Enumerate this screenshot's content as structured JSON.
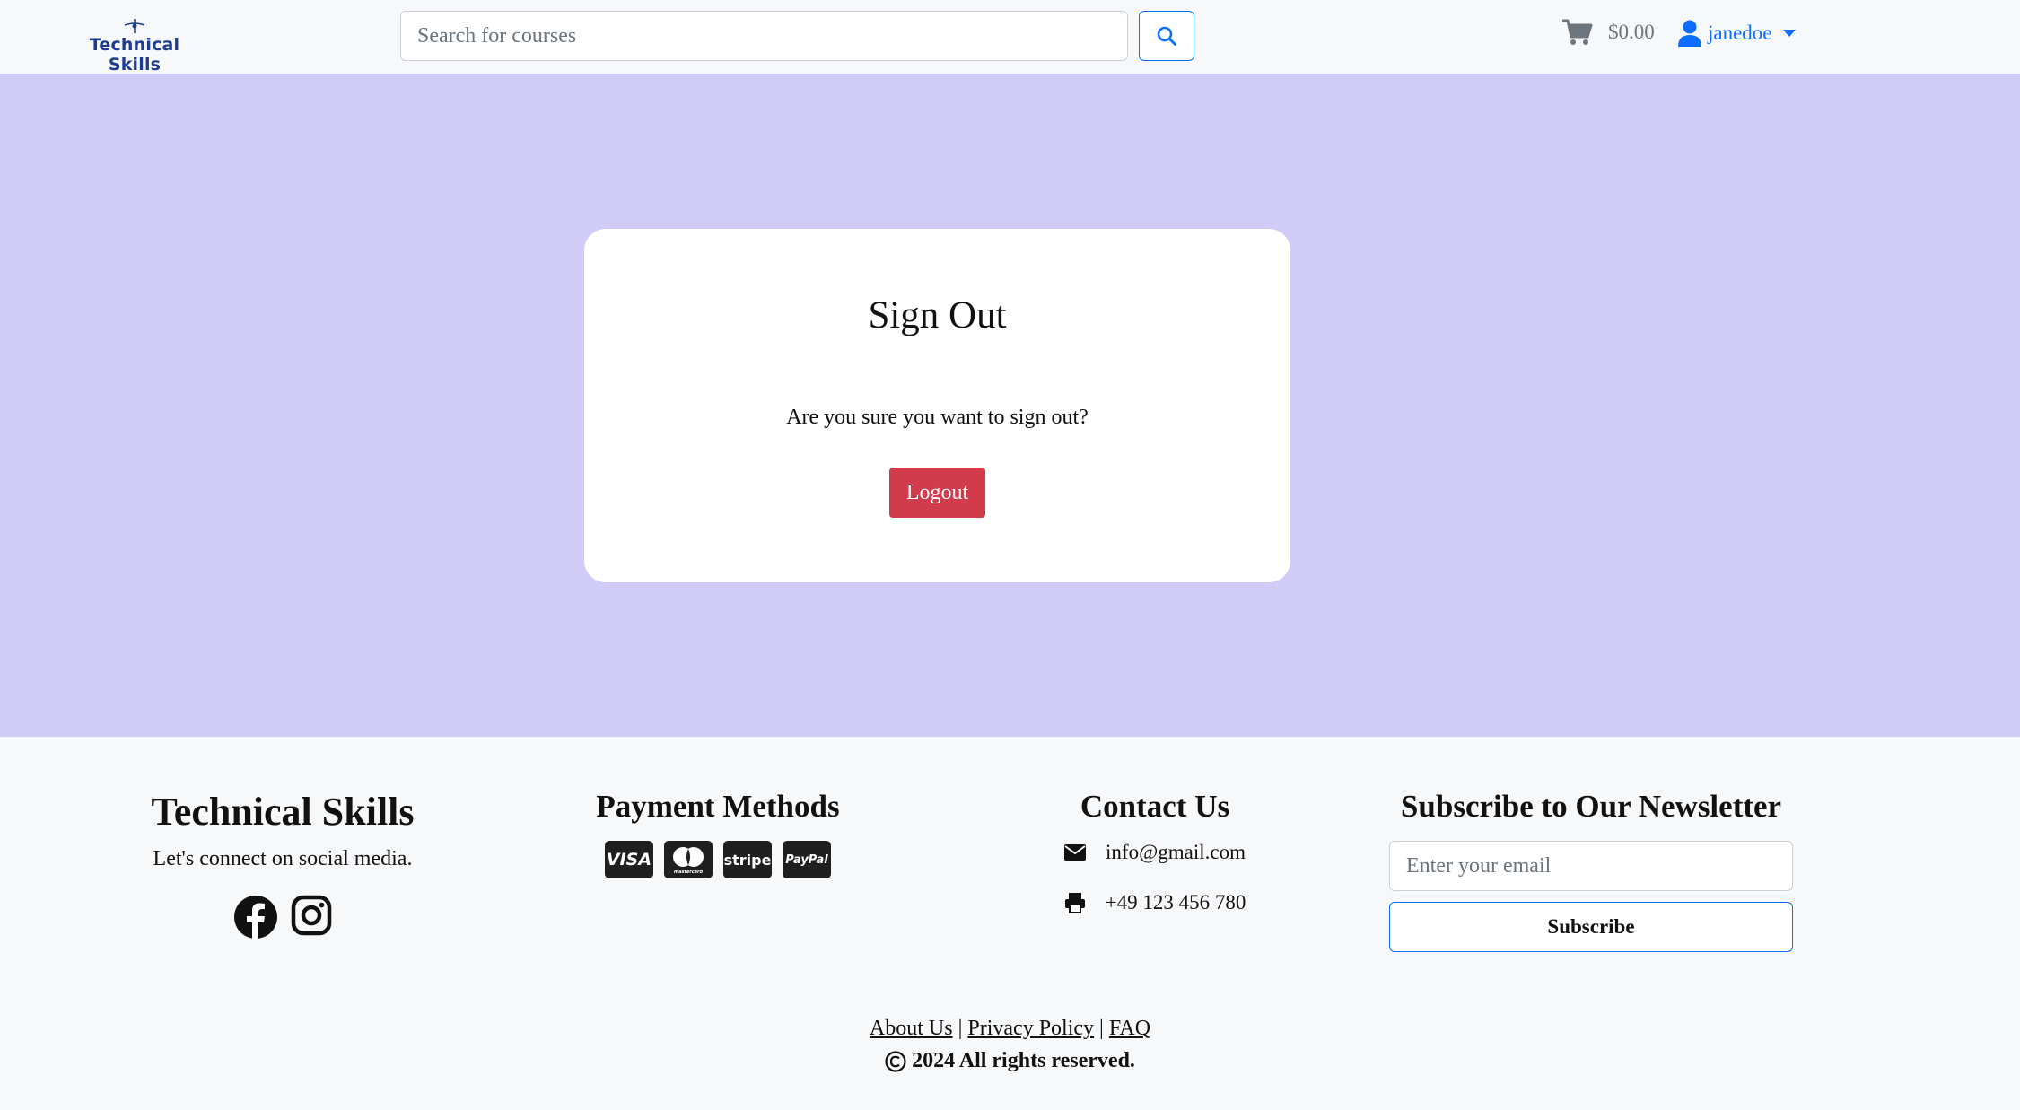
{
  "nav": {
    "brand": "Technical Skills",
    "search_placeholder": "Search for courses",
    "cart_total": "$0.00",
    "username": "janedoe"
  },
  "signout": {
    "title": "Sign Out",
    "prompt": "Are you sure you want to sign out?",
    "logout_label": "Logout"
  },
  "footer": {
    "brand": {
      "title": "Technical Skills",
      "tagline": "Let's connect on social media.",
      "social_icons": [
        "facebook-icon",
        "instagram-icon"
      ]
    },
    "payment": {
      "title": "Payment Methods",
      "methods": [
        "VISA",
        "mastercard",
        "stripe",
        "PayPal"
      ]
    },
    "contact": {
      "title": "Contact Us",
      "email": "info@gmail.com",
      "phone": "+49 123 456 780"
    },
    "newsletter": {
      "title": "Subscribe to Our Newsletter",
      "email_placeholder": "Enter your email",
      "button": "Subscribe"
    },
    "links": [
      "About Us",
      "Privacy Policy",
      "FAQ"
    ],
    "link_separator": "|",
    "copyright": "2024 All rights reserved."
  },
  "colors": {
    "accent": "#0d6efd",
    "main_background": "#d1cbf8",
    "logout_button": "#d13b4b",
    "logo_text": "#1d3b8f"
  }
}
